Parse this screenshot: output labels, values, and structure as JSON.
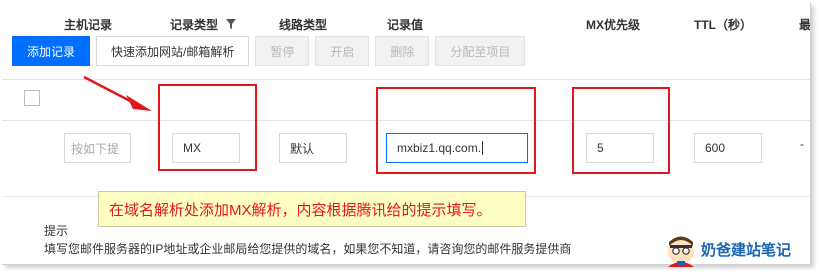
{
  "toolbar": {
    "add_record": "添加记录",
    "quick_add": "快速添加网站/邮箱解析",
    "pause": "暂停",
    "enable": "开启",
    "delete": "删除",
    "assign_project": "分配至项目"
  },
  "table": {
    "headers": {
      "host": "主机记录",
      "record_type": "记录类型",
      "line_type": "线路类型",
      "record_value": "记录值",
      "mx_priority": "MX优先级",
      "ttl": "TTL（秒）",
      "last_partial": "最"
    },
    "row": {
      "host_placeholder": "按如下提",
      "record_type": "MX",
      "line_type": "默认",
      "record_value": "mxbiz1.qq.com.",
      "mx_priority": "5",
      "ttl": "600",
      "last": "-"
    }
  },
  "annotation": {
    "note": "在域名解析处添加MX解析，内容根据腾讯给的提示填写。"
  },
  "hint": {
    "title": "提示",
    "text": "填写您邮件服务器的IP地址或企业邮局给您提供的域名，如果您不知道，请咨询您的邮件服务提供商"
  },
  "watermark": {
    "name": "奶爸建站笔记"
  },
  "colors": {
    "primary": "#006eff",
    "annotation_red": "#e4161c",
    "note_bg": "#ffffc4",
    "brand_blue": "#1a66b3"
  }
}
